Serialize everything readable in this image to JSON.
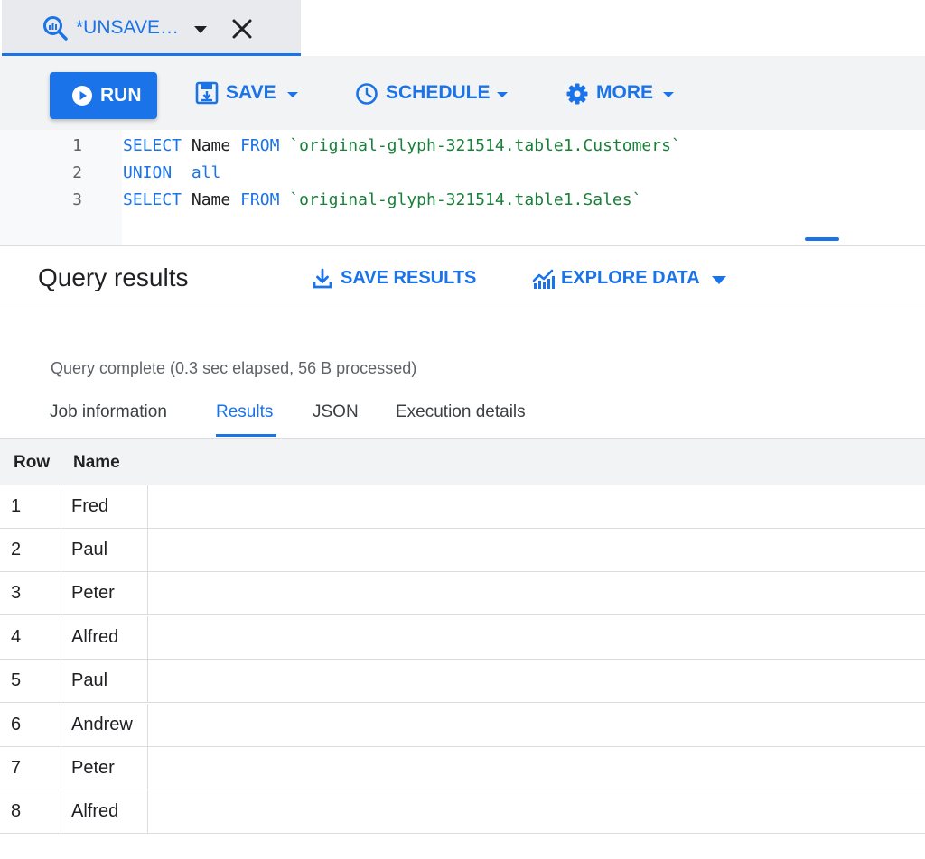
{
  "tab": {
    "title": "*UNSAVE…"
  },
  "toolbar": {
    "run_label": "RUN",
    "save_label": "SAVE",
    "schedule_label": "SCHEDULE",
    "more_label": "MORE"
  },
  "editor": {
    "line_numbers": [
      "1",
      "2",
      "3"
    ],
    "lines": [
      {
        "kw1": "SELECT",
        "id": "Name",
        "kw2": "FROM",
        "str": "`original-glyph-321514.table1.Customers`"
      },
      {
        "kw1": "UNION",
        "kw2": "all"
      },
      {
        "kw1": "SELECT",
        "id": "Name",
        "kw2": "FROM",
        "str": "`original-glyph-321514.table1.Sales`"
      }
    ]
  },
  "results": {
    "title": "Query results",
    "save_results_label": "SAVE RESULTS",
    "explore_data_label": "EXPLORE DATA",
    "status": "Query complete (0.3 sec elapsed, 56 B processed)",
    "tabs": [
      "Job information",
      "Results",
      "JSON",
      "Execution details"
    ],
    "active_tab": "Results"
  },
  "table": {
    "columns": [
      "Row",
      "Name"
    ],
    "rows": [
      {
        "row": "1",
        "name": "Fred"
      },
      {
        "row": "2",
        "name": "Paul"
      },
      {
        "row": "3",
        "name": "Peter"
      },
      {
        "row": "4",
        "name": "Alfred"
      },
      {
        "row": "5",
        "name": "Paul"
      },
      {
        "row": "6",
        "name": "Andrew"
      },
      {
        "row": "7",
        "name": "Peter"
      },
      {
        "row": "8",
        "name": "Alfred"
      }
    ]
  },
  "colors": {
    "accent": "#1a73e8",
    "keyword": "#1a73e8",
    "string": "#188038",
    "toolbar_bg": "#f1f3f4",
    "tab_bg": "#e8eaed"
  },
  "icons": {
    "tab": "query-magnifier-icon",
    "tab_caret": "caret-down-icon",
    "close": "close-icon",
    "run": "play-circle-icon",
    "save": "save-disk-icon",
    "schedule": "clock-icon",
    "more": "gear-icon",
    "save_results": "download-icon",
    "explore_data": "chart-icon"
  }
}
